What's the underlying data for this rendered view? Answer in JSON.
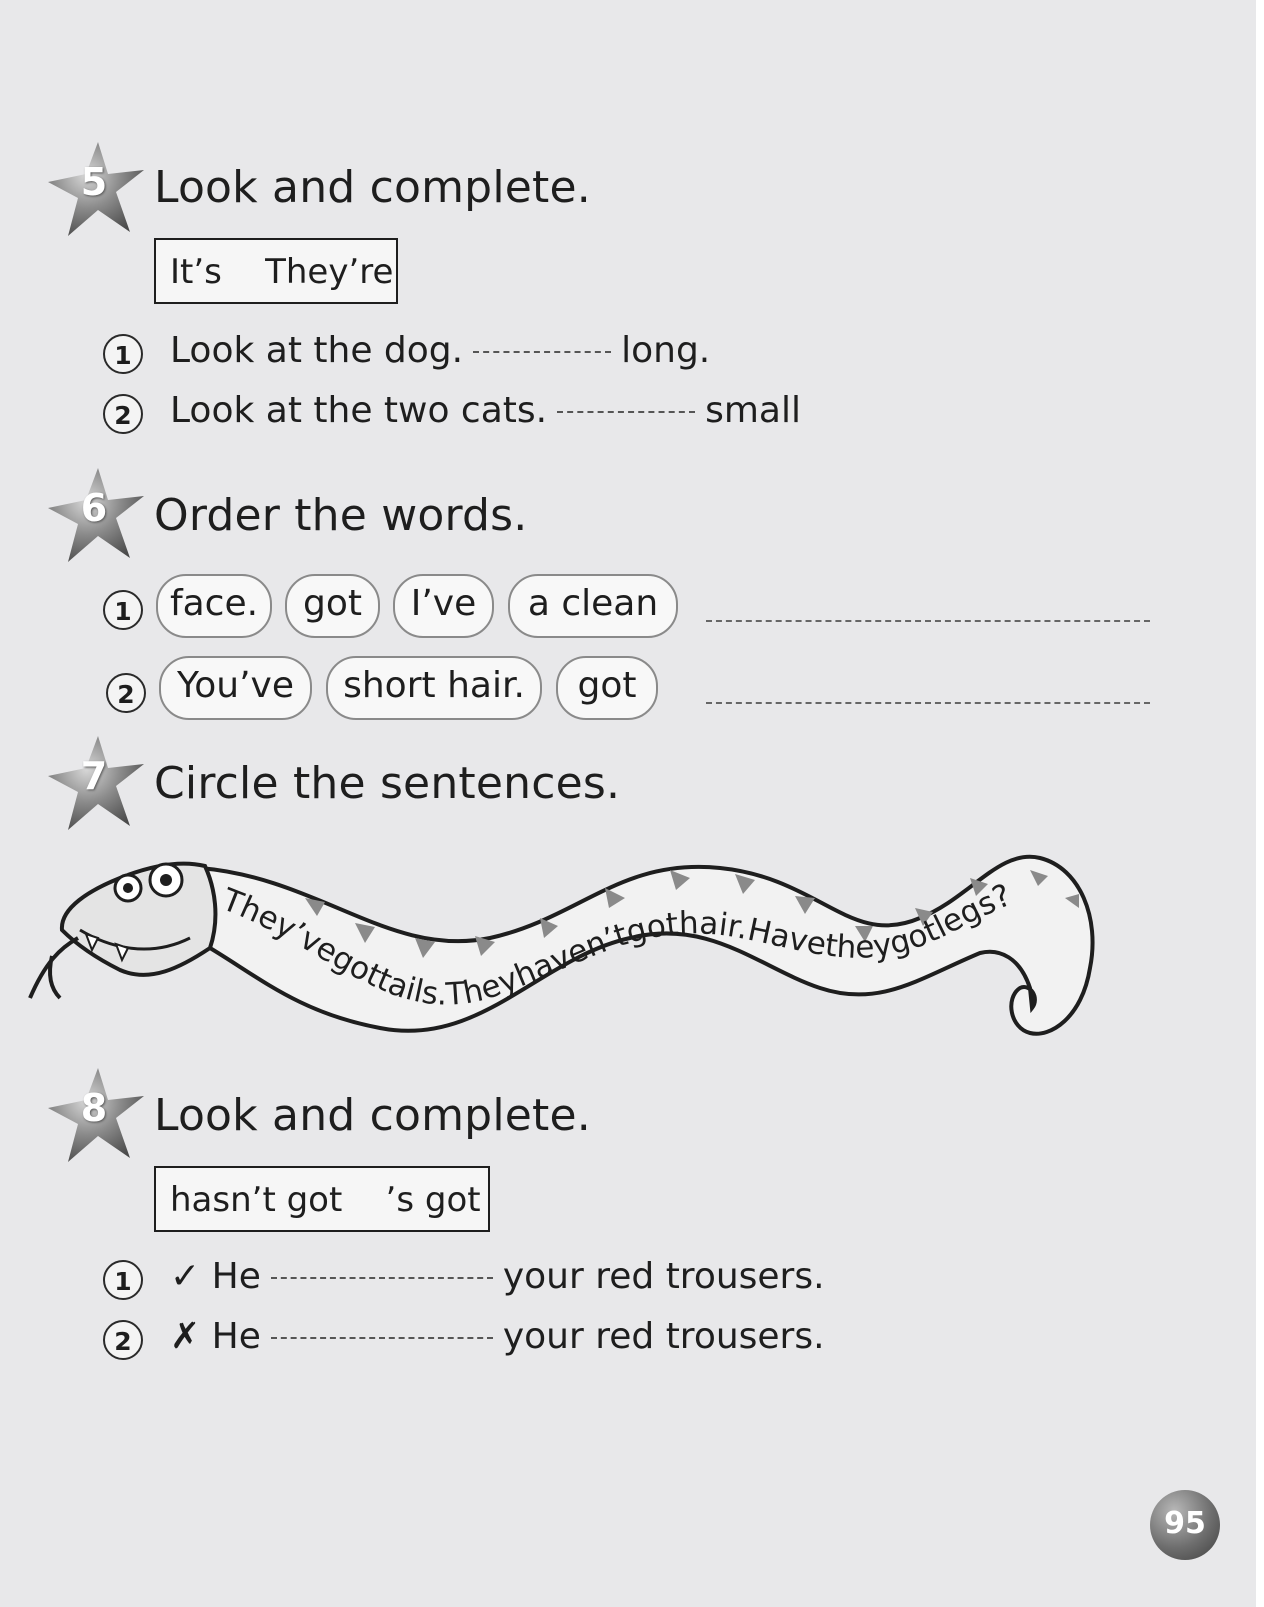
{
  "sections": [
    {
      "number": "5",
      "title": "Look and complete.",
      "word_box": "It’s    They’re",
      "items": [
        {
          "num": "1",
          "before": "Look at the dog.",
          "after": "long."
        },
        {
          "num": "2",
          "before": "Look at the two cats.",
          "after": "small"
        }
      ]
    },
    {
      "number": "6",
      "title": "Order the words.",
      "items": [
        {
          "num": "1",
          "words": [
            "face.",
            "got",
            "I’ve",
            "a clean"
          ]
        },
        {
          "num": "2",
          "words": [
            "You’ve",
            "short hair.",
            "got"
          ]
        }
      ]
    },
    {
      "number": "7",
      "title": "Circle the sentences.",
      "snake_text": "They’vegottails.Theyhaven’tgothair.Havetheygotlegs?"
    },
    {
      "number": "8",
      "title": "Look and complete.",
      "word_box": "hasn’t got    ’s got",
      "items": [
        {
          "num": "1",
          "mark": "✓",
          "before": "He",
          "after": "your red trousers."
        },
        {
          "num": "2",
          "mark": "✗",
          "before": "He",
          "after": "your red trousers."
        }
      ]
    }
  ],
  "page_number": "95",
  "icons": {
    "section_badge": "star-badge-icon",
    "snake": "snake-illustration"
  }
}
